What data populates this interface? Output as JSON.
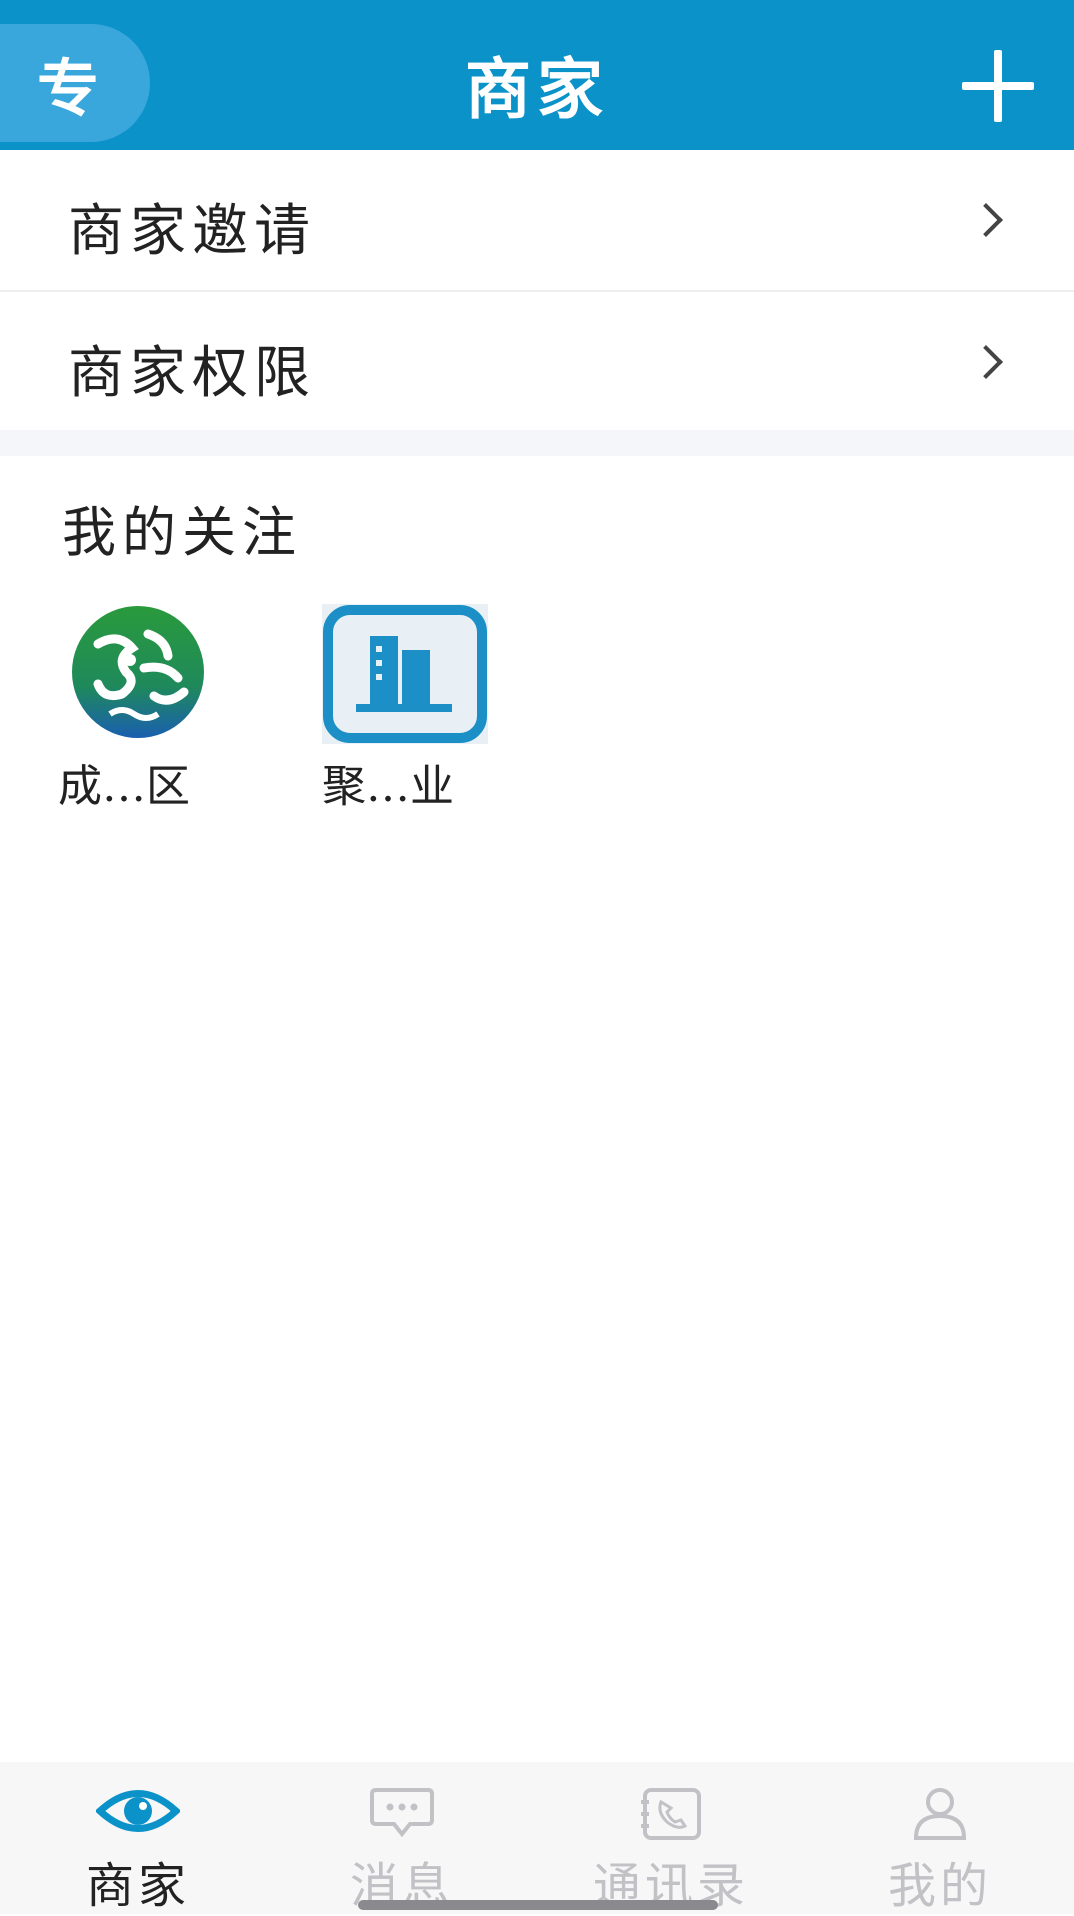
{
  "header": {
    "badge": "专",
    "title": "商家",
    "add_icon": "plus-icon"
  },
  "menu": [
    {
      "label": "商家邀请",
      "icon": "chevron-right-icon"
    },
    {
      "label": "商家权限",
      "icon": "chevron-right-icon"
    }
  ],
  "favorites": {
    "title": "我的关注",
    "items": [
      {
        "name": "成…区",
        "icon": "green-logo-icon"
      },
      {
        "name": "聚…业",
        "icon": "building-icon"
      }
    ]
  },
  "tabbar": {
    "active_color": "#0b93c9",
    "items": [
      {
        "label": "商家",
        "icon": "eye-icon",
        "active": true
      },
      {
        "label": "消息",
        "icon": "message-icon",
        "active": false
      },
      {
        "label": "通讯录",
        "icon": "phone-book-icon",
        "active": false
      },
      {
        "label": "我的",
        "icon": "person-icon",
        "active": false
      }
    ]
  },
  "colors": {
    "header_bg": "#0b93c9",
    "badge_bg": "#39a7dc"
  }
}
